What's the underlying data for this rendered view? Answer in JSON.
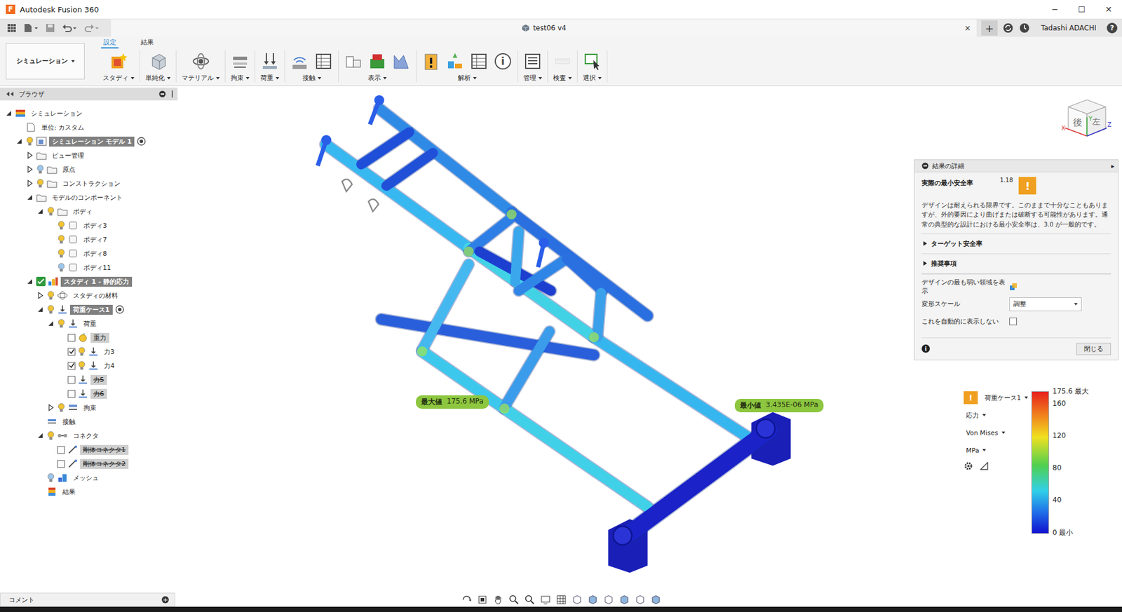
{
  "window": {
    "app_icon": "F",
    "title": "Autodesk Fusion 360",
    "controls": [
      "─",
      "☐",
      "✕"
    ]
  },
  "tabbar": {
    "document": {
      "title": "test06 v4",
      "close": "✕"
    },
    "new_tab": "+",
    "user": "Tadashi ADACHI",
    "help": "?"
  },
  "toolbar": {
    "workspace": "シミュレーション",
    "tabs": [
      {
        "label": "設定",
        "selected": true
      },
      {
        "label": "結果",
        "selected": false
      }
    ],
    "groups": [
      {
        "label": "スタディ",
        "tools": [
          {
            "kind": "study",
            "disabled": false,
            "glyph": ""
          }
        ]
      },
      {
        "label": "単純化",
        "tools": [
          {
            "kind": "simplify",
            "disabled": false,
            "glyph": ""
          }
        ]
      },
      {
        "label": "マテリアル",
        "tools": [
          {
            "kind": "material",
            "disabled": false,
            "glyph": ""
          }
        ]
      },
      {
        "label": "拘束",
        "tools": [
          {
            "kind": "constraint",
            "disabled": false,
            "glyph": ""
          }
        ]
      },
      {
        "label": "荷重",
        "tools": [
          {
            "kind": "load",
            "disabled": false,
            "glyph": ""
          }
        ]
      },
      {
        "label": "接触",
        "tools": [
          {
            "kind": "contact",
            "disabled": false,
            "glyph": ""
          },
          {
            "kind": "table",
            "disabled": false,
            "glyph": ""
          }
        ]
      },
      {
        "label": "表示",
        "tools": [
          {
            "kind": "display-a",
            "disabled": false,
            "glyph": ""
          },
          {
            "kind": "display-b",
            "disabled": false,
            "glyph": ""
          },
          {
            "kind": "display-c",
            "disabled": false,
            "glyph": ""
          }
        ]
      },
      {
        "label": "解析",
        "tools": [
          {
            "kind": "precheck",
            "disabled": false,
            "glyph": ""
          },
          {
            "kind": "solve",
            "disabled": false,
            "glyph": ""
          },
          {
            "kind": "table",
            "disabled": false,
            "glyph": ""
          },
          {
            "kind": "info",
            "disabled": false,
            "glyph": "i"
          }
        ]
      },
      {
        "label": "管理",
        "tools": [
          {
            "kind": "manage",
            "disabled": false,
            "glyph": ""
          }
        ]
      },
      {
        "label": "検査",
        "tools": [
          {
            "kind": "inspect",
            "disabled": true,
            "glyph": ""
          }
        ]
      },
      {
        "label": "選択",
        "tools": [
          {
            "kind": "select",
            "disabled": false,
            "glyph": ""
          }
        ]
      }
    ]
  },
  "browser": {
    "title": "ブラウザ",
    "items": [
      {
        "level": 0,
        "expandable": true,
        "expanded": true,
        "checkbox": false,
        "checked": false,
        "valid": false,
        "bulb": "none",
        "icon": "sim-root",
        "label": "シミュレーション",
        "highlight": "none",
        "strike": false,
        "target": false
      },
      {
        "level": 1,
        "expandable": false,
        "expanded": false,
        "checkbox": false,
        "checked": false,
        "valid": false,
        "bulb": "none",
        "icon": "units",
        "label": "単位: カスタム",
        "highlight": "none",
        "strike": false,
        "target": false
      },
      {
        "level": 1,
        "expandable": true,
        "expanded": true,
        "checkbox": false,
        "checked": false,
        "valid": false,
        "bulb": "on",
        "icon": "sim-model",
        "label": "シミュレーション モデル 1",
        "highlight": "strong",
        "strike": false,
        "target": true
      },
      {
        "level": 2,
        "expandable": true,
        "expanded": false,
        "checkbox": false,
        "checked": false,
        "valid": false,
        "bulb": "none",
        "icon": "folder",
        "label": "ビュー管理",
        "highlight": "none",
        "strike": false,
        "target": false
      },
      {
        "level": 2,
        "expandable": true,
        "expanded": false,
        "checkbox": false,
        "checked": false,
        "valid": false,
        "bulb": "off",
        "icon": "folder",
        "label": "原点",
        "highlight": "none",
        "strike": false,
        "target": false
      },
      {
        "level": 2,
        "expandable": true,
        "expanded": false,
        "checkbox": false,
        "checked": false,
        "valid": false,
        "bulb": "on",
        "icon": "folder",
        "label": "コンストラクション",
        "highlight": "none",
        "strike": false,
        "target": false
      },
      {
        "level": 2,
        "expandable": true,
        "expanded": true,
        "checkbox": false,
        "checked": false,
        "valid": false,
        "bulb": "none",
        "icon": "folder",
        "label": "モデルのコンポーネント",
        "highlight": "none",
        "strike": false,
        "target": false
      },
      {
        "level": 3,
        "expandable": true,
        "expanded": true,
        "checkbox": false,
        "checked": false,
        "valid": false,
        "bulb": "on",
        "icon": "folder",
        "label": "ボディ",
        "highlight": "none",
        "strike": false,
        "target": false
      },
      {
        "level": 4,
        "expandable": false,
        "expanded": false,
        "checkbox": false,
        "checked": false,
        "valid": false,
        "bulb": "on",
        "icon": "body",
        "label": "ボディ3",
        "highlight": "none",
        "strike": false,
        "target": false
      },
      {
        "level": 4,
        "expandable": false,
        "expanded": false,
        "checkbox": false,
        "checked": false,
        "valid": false,
        "bulb": "on",
        "icon": "body",
        "label": "ボディ7",
        "highlight": "none",
        "strike": false,
        "target": false
      },
      {
        "level": 4,
        "expandable": false,
        "expanded": false,
        "checkbox": false,
        "checked": false,
        "valid": false,
        "bulb": "on",
        "icon": "body",
        "label": "ボディ8",
        "highlight": "none",
        "strike": false,
        "target": false
      },
      {
        "level": 4,
        "expandable": false,
        "expanded": false,
        "checkbox": false,
        "checked": false,
        "valid": false,
        "bulb": "off",
        "icon": "body",
        "label": "ボディ11",
        "highlight": "none",
        "strike": false,
        "target": false
      },
      {
        "level": 2,
        "expandable": true,
        "expanded": true,
        "checkbox": false,
        "checked": false,
        "valid": true,
        "bulb": "none",
        "icon": "study",
        "label": "スタディ 1 - 静的応力",
        "highlight": "strong",
        "strike": false,
        "target": false
      },
      {
        "level": 3,
        "expandable": true,
        "expanded": false,
        "checkbox": false,
        "checked": false,
        "valid": false,
        "bulb": "on",
        "icon": "material",
        "label": "スタディの材料",
        "highlight": "none",
        "strike": false,
        "target": false
      },
      {
        "level": 3,
        "expandable": true,
        "expanded": true,
        "checkbox": false,
        "checked": false,
        "valid": false,
        "bulb": "on",
        "icon": "load-case",
        "label": "荷重ケース1",
        "highlight": "strong",
        "strike": false,
        "target": true
      },
      {
        "level": 4,
        "expandable": true,
        "expanded": true,
        "checkbox": false,
        "checked": false,
        "valid": false,
        "bulb": "on",
        "icon": "load",
        "label": "荷重",
        "highlight": "none",
        "strike": false,
        "target": false
      },
      {
        "level": 5,
        "expandable": false,
        "expanded": false,
        "checkbox": true,
        "checked": false,
        "valid": false,
        "bulb": "none",
        "icon": "gravity",
        "label": "重力",
        "highlight": "light",
        "strike": false,
        "target": false
      },
      {
        "level": 5,
        "expandable": false,
        "expanded": false,
        "checkbox": true,
        "checked": true,
        "valid": false,
        "bulb": "on",
        "icon": "force",
        "label": "力3",
        "highlight": "none",
        "strike": false,
        "target": false
      },
      {
        "level": 5,
        "expandable": false,
        "expanded": false,
        "checkbox": true,
        "checked": true,
        "valid": false,
        "bulb": "on",
        "icon": "force",
        "label": "力4",
        "highlight": "none",
        "strike": false,
        "target": false
      },
      {
        "level": 5,
        "expandable": false,
        "expanded": false,
        "checkbox": true,
        "checked": false,
        "valid": false,
        "bulb": "none",
        "icon": "force",
        "label": "力5",
        "highlight": "light",
        "strike": true,
        "target": false
      },
      {
        "level": 5,
        "expandable": false,
        "expanded": false,
        "checkbox": true,
        "checked": false,
        "valid": false,
        "bulb": "none",
        "icon": "force",
        "label": "力6",
        "highlight": "light",
        "strike": true,
        "target": false
      },
      {
        "level": 4,
        "expandable": true,
        "expanded": false,
        "checkbox": false,
        "checked": false,
        "valid": false,
        "bulb": "on",
        "icon": "constraint",
        "label": "拘束",
        "highlight": "none",
        "strike": false,
        "target": false
      },
      {
        "level": 3,
        "expandable": false,
        "expanded": false,
        "checkbox": false,
        "checked": false,
        "valid": false,
        "bulb": "none",
        "icon": "contact",
        "label": "接触",
        "highlight": "none",
        "strike": false,
        "target": false
      },
      {
        "level": 3,
        "expandable": true,
        "expanded": true,
        "checkbox": false,
        "checked": false,
        "valid": false,
        "bulb": "on",
        "icon": "connector",
        "label": "コネクタ",
        "highlight": "none",
        "strike": false,
        "target": false
      },
      {
        "level": 4,
        "expandable": false,
        "expanded": false,
        "checkbox": true,
        "checked": false,
        "valid": false,
        "bulb": "none",
        "icon": "rigid",
        "label": "剛体コネクタ1",
        "highlight": "light",
        "strike": true,
        "target": false
      },
      {
        "level": 4,
        "expandable": false,
        "expanded": false,
        "checkbox": true,
        "checked": false,
        "valid": false,
        "bulb": "none",
        "icon": "rigid",
        "label": "剛体コネクタ2",
        "highlight": "light",
        "strike": true,
        "target": false
      },
      {
        "level": 3,
        "expandable": false,
        "expanded": false,
        "checkbox": false,
        "checked": false,
        "valid": false,
        "bulb": "off",
        "icon": "mesh",
        "label": "メッシュ",
        "highlight": "none",
        "strike": false,
        "target": false
      },
      {
        "level": 3,
        "expandable": false,
        "expanded": false,
        "checkbox": false,
        "checked": false,
        "valid": false,
        "bulb": "none",
        "icon": "results",
        "label": "結果",
        "highlight": "none",
        "strike": false,
        "target": false
      }
    ]
  },
  "viewport": {
    "max": {
      "label": "最大値",
      "value": "175.6 MPa"
    },
    "min": {
      "label": "最小値",
      "value": "3.435E-06 MPa"
    }
  },
  "viewcube": {
    "face": "後",
    "side": "左",
    "axes": [
      "X",
      "Y",
      "Z"
    ]
  },
  "result_panel": {
    "title": "結果の詳細",
    "collapse": "▸",
    "safety_factor": {
      "label": "実際の最小安全率",
      "value": "1.18",
      "badge": "!"
    },
    "message": "デザインは耐えられる限界です。このままで十分なこともありますが、外的要因により曲げまたは破断する可能性があります。通常の典型的な設計における最小安全率は、3.0 が一般的です。",
    "sections": [
      {
        "label": "ターゲット安全率",
        "expanded": false
      },
      {
        "label": "推奨事項",
        "expanded": false
      }
    ],
    "weakest": {
      "label": "デザインの最も弱い領域を表示"
    },
    "deform": {
      "label": "変形スケール",
      "value": "調整"
    },
    "dont_show": {
      "label": "これを自動的に表示しない",
      "checked": false
    },
    "info": "i",
    "close": "閉じる"
  },
  "legend": {
    "badge": "!",
    "selectors": [
      "荷重ケース1",
      "応力",
      "Von Mises",
      "MPa"
    ],
    "ticks": [
      {
        "label": "175.6 最大",
        "level": 1
      },
      {
        "label": "160",
        "level": 0.911
      },
      {
        "label": "120",
        "level": 0.683
      },
      {
        "label": "80",
        "level": 0.456
      },
      {
        "label": "40",
        "level": 0.228
      },
      {
        "label": "0 最小",
        "level": 0
      }
    ]
  },
  "comments": {
    "label": "コメント",
    "add": "+"
  }
}
